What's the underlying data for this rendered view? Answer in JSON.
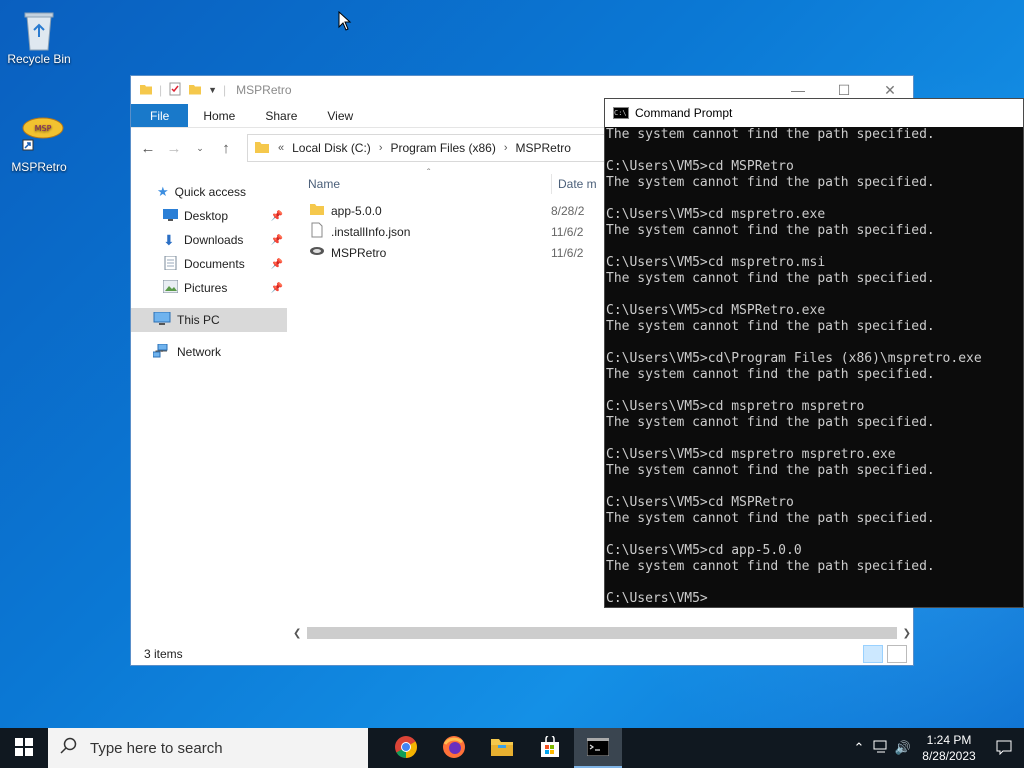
{
  "desktop": {
    "icons": [
      {
        "label": "Recycle Bin",
        "icon": "recycle-bin-icon"
      },
      {
        "label": "MSPRetro",
        "icon": "msp-retro-icon"
      }
    ]
  },
  "explorer": {
    "title": "MSPRetro",
    "ribbon_tabs": [
      "File",
      "Home",
      "Share",
      "View"
    ],
    "address": {
      "segments": [
        "Local Disk (C:)",
        "Program Files (x86)",
        "MSPRetro"
      ],
      "overflow": "«"
    },
    "nav": {
      "quick_access": "Quick access",
      "pinned": [
        "Desktop",
        "Downloads",
        "Documents",
        "Pictures"
      ],
      "this_pc": "This PC",
      "network": "Network"
    },
    "columns": {
      "name": "Name",
      "date": "Date m"
    },
    "files": [
      {
        "name": "app-5.0.0",
        "date": "8/28/2",
        "icon": "folder-icon"
      },
      {
        "name": ".installInfo.json",
        "date": "11/6/2",
        "icon": "document-icon"
      },
      {
        "name": "MSPRetro",
        "date": "11/6/2",
        "icon": "app-shortcut-icon"
      }
    ],
    "status": "3 items"
  },
  "cmd": {
    "title": "Command Prompt",
    "lines": [
      "The system cannot find the path specified.",
      "",
      "C:\\Users\\VM5>cd MSPRetro",
      "The system cannot find the path specified.",
      "",
      "C:\\Users\\VM5>cd mspretro.exe",
      "The system cannot find the path specified.",
      "",
      "C:\\Users\\VM5>cd mspretro.msi",
      "The system cannot find the path specified.",
      "",
      "C:\\Users\\VM5>cd MSPRetro.exe",
      "The system cannot find the path specified.",
      "",
      "C:\\Users\\VM5>cd\\Program Files (x86)\\mspretro.exe",
      "The system cannot find the path specified.",
      "",
      "C:\\Users\\VM5>cd mspretro mspretro",
      "The system cannot find the path specified.",
      "",
      "C:\\Users\\VM5>cd mspretro mspretro.exe",
      "The system cannot find the path specified.",
      "",
      "C:\\Users\\VM5>cd MSPRetro",
      "The system cannot find the path specified.",
      "",
      "C:\\Users\\VM5>cd app-5.0.0",
      "The system cannot find the path specified.",
      "",
      "C:\\Users\\VM5>"
    ]
  },
  "taskbar": {
    "search_placeholder": "Type here to search",
    "apps": [
      "chrome-icon",
      "firefox-icon",
      "file-explorer-icon",
      "store-icon",
      "command-prompt-icon"
    ],
    "time": "1:24 PM",
    "date": "8/28/2023"
  }
}
